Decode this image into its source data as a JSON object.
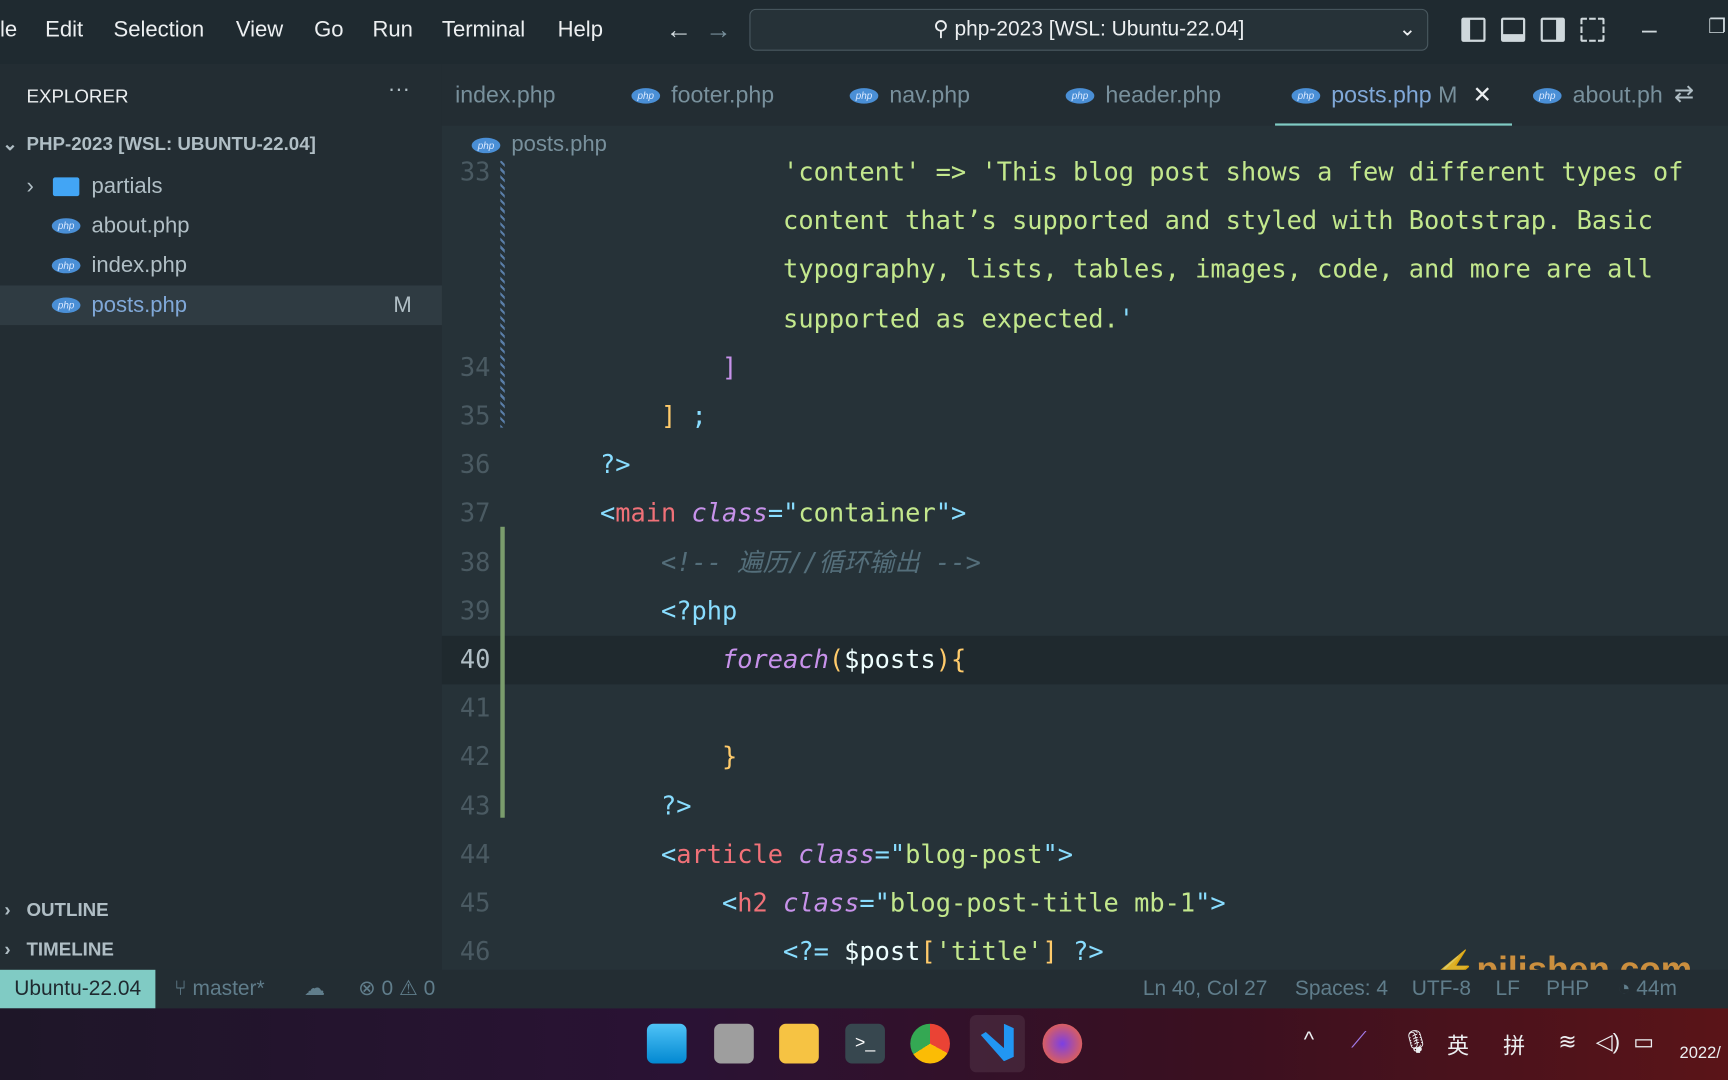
{
  "titlebar": {
    "menu": [
      "le",
      "Edit",
      "Selection",
      "View",
      "Go",
      "Run",
      "Terminal",
      "Help"
    ],
    "search": "php-2023 [WSL: Ubuntu-22.04]"
  },
  "sidebar": {
    "title": "EXPLORER",
    "more": "···",
    "folder": "PHP-2023 [WSL: UBUNTU-22.04]",
    "items": [
      {
        "label": "partials",
        "type": "folder"
      },
      {
        "label": "about.php",
        "type": "php"
      },
      {
        "label": "index.php",
        "type": "php"
      },
      {
        "label": "posts.php",
        "type": "php",
        "badge": "M",
        "selected": true
      }
    ],
    "outline": "OUTLINE",
    "timeline": "TIMELINE"
  },
  "tabs": [
    {
      "label": "index.php"
    },
    {
      "label": "footer.php"
    },
    {
      "label": "nav.php"
    },
    {
      "label": "header.php"
    },
    {
      "label": "posts.php",
      "badge": "M",
      "active": true
    },
    {
      "label": "about.ph"
    }
  ],
  "php_icon": "php",
  "breadcrumb": "posts.php",
  "code": [
    {
      "n": "33",
      "t": [
        [
          "                'content' => 'This blog post shows a few different types of",
          "t-str"
        ]
      ]
    },
    {
      "n": "",
      "t": [
        [
          "                content that’s supported and styled with Bootstrap. Basic",
          "t-str"
        ]
      ]
    },
    {
      "n": "",
      "t": [
        [
          "                typography, lists, tables, images, code, and more are all",
          "t-str"
        ]
      ]
    },
    {
      "n": "",
      "t": [
        [
          "                supported as expected.",
          "t-str"
        ],
        [
          "'",
          "t-p"
        ]
      ]
    },
    {
      "n": "34",
      "t": [
        [
          "            ",
          "t-d"
        ],
        [
          "]",
          "t-pk"
        ]
      ]
    },
    {
      "n": "35",
      "t": [
        [
          "        ",
          "t-d"
        ],
        [
          "]",
          "t-y"
        ],
        [
          " ;",
          "t-p"
        ]
      ]
    },
    {
      "n": "36",
      "t": [
        [
          "    ?>",
          "t-p"
        ]
      ]
    },
    {
      "n": "37",
      "t": [
        [
          "    <",
          "t-p"
        ],
        [
          "main",
          "t-tag"
        ],
        [
          " class",
          "t-attr"
        ],
        [
          "=\"",
          "t-p"
        ],
        [
          "container",
          "t-str"
        ],
        [
          "\">",
          "t-p"
        ]
      ]
    },
    {
      "n": "38",
      "t": [
        [
          "        <!-- 遍历//循环输出 -->",
          "t-cm"
        ]
      ]
    },
    {
      "n": "39",
      "t": [
        [
          "        <?php",
          "t-p"
        ]
      ]
    },
    {
      "n": "40",
      "t": [
        [
          "            ",
          "t-d"
        ],
        [
          "foreach",
          "t-kw"
        ],
        [
          "(",
          "t-y"
        ],
        [
          "$posts",
          "t-var"
        ],
        [
          ")",
          "t-y"
        ],
        [
          "{",
          "t-y"
        ]
      ],
      "current": true
    },
    {
      "n": "41",
      "t": []
    },
    {
      "n": "42",
      "t": [
        [
          "            }",
          "t-y"
        ]
      ]
    },
    {
      "n": "43",
      "t": [
        [
          "        ?>",
          "t-p"
        ]
      ]
    },
    {
      "n": "44",
      "t": [
        [
          "        <",
          "t-p"
        ],
        [
          "article",
          "t-tag"
        ],
        [
          " class",
          "t-attr"
        ],
        [
          "=\"",
          "t-p"
        ],
        [
          "blog-post",
          "t-str"
        ],
        [
          "\">",
          "t-p"
        ]
      ]
    },
    {
      "n": "45",
      "t": [
        [
          "            <",
          "t-p"
        ],
        [
          "h2",
          "t-tag"
        ],
        [
          " class",
          "t-attr"
        ],
        [
          "=\"",
          "t-p"
        ],
        [
          "blog-post-title mb-1",
          "t-str"
        ],
        [
          "\">",
          "t-p"
        ]
      ]
    },
    {
      "n": "46",
      "t": [
        [
          "                <?= ",
          "t-p"
        ],
        [
          "$post",
          "t-var"
        ],
        [
          "[",
          "t-y"
        ],
        [
          "'title'",
          "t-str"
        ],
        [
          "]",
          "t-y"
        ],
        [
          " ?>",
          "t-p"
        ]
      ]
    }
  ],
  "statusbar": {
    "remote": "Ubuntu-22.04",
    "branch": "master*",
    "problems": "⊗ 0 ⚠ 0",
    "position": "Ln 40, Col 27",
    "spaces": "Spaces: 4",
    "encoding": "UTF-8",
    "eol": "LF",
    "language": "PHP",
    "time": "44m"
  },
  "taskbar": {
    "ime1": "英",
    "ime2": "拼",
    "clock": "2022/"
  },
  "watermark": "pilishen.com",
  "colors": {
    "accent": "#80cbc4",
    "editor_bg": "#263238",
    "sidebar_bg": "#232d33"
  }
}
